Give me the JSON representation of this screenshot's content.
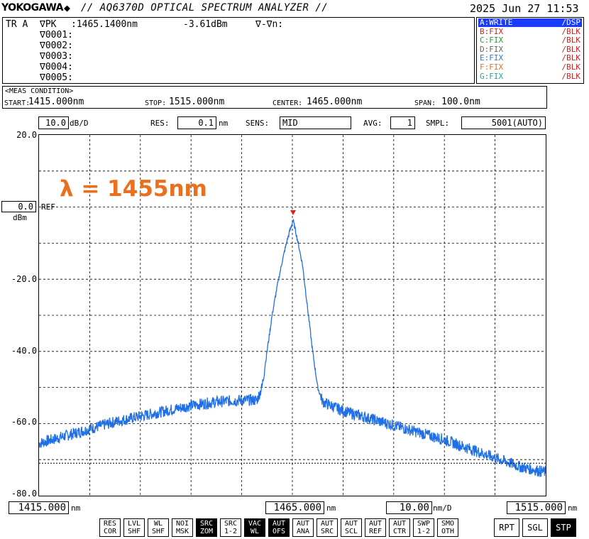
{
  "header": {
    "brand": "YOKOGAWA",
    "brand_icon": "diamond-logo-icon",
    "model_title": "// AQ6370D OPTICAL SPECTRUM ANALYZER //",
    "datetime": "2025 Jun 27 11:53"
  },
  "marker_panel": {
    "trace_label": "TR A",
    "peak_label": "∇PK",
    "peak_wavelength": ":1465.1400nm",
    "peak_level": "-3.61dBm",
    "delta_label": "∇-∇n:",
    "markers": [
      "∇0001:",
      "∇0002:",
      "∇0003:",
      "∇0004:",
      "∇0005:"
    ]
  },
  "traces": [
    {
      "name": "A:WRITE",
      "mode": "/DSP",
      "color": "#ffffff",
      "bg": "#1a3cff"
    },
    {
      "name": "B:FIX",
      "mode": "/BLK",
      "color": "#d02020",
      "bg": ""
    },
    {
      "name": "C:FIX",
      "mode": "/BLK",
      "color": "#2a9a2a",
      "bg": ""
    },
    {
      "name": "D:FIX",
      "mode": "/BLK",
      "color": "#666666",
      "bg": ""
    },
    {
      "name": "E:FIX",
      "mode": "/BLK",
      "color": "#2a7acc",
      "bg": ""
    },
    {
      "name": "F:FIX",
      "mode": "/BLK",
      "color": "#e07020",
      "bg": ""
    },
    {
      "name": "G:FIX",
      "mode": "/BLK",
      "color": "#2aa0a0",
      "bg": ""
    }
  ],
  "meas_condition": {
    "title": "<MEAS CONDITION>",
    "start_label": "START:",
    "start_value": "1415.000nm",
    "stop_label": "STOP:",
    "stop_value": "1515.000nm",
    "center_label": "CENTER:",
    "center_value": "1465.000nm",
    "span_label": "SPAN:",
    "span_value": "100.0nm"
  },
  "scale": {
    "div_value": "10.0",
    "div_unit": "dB/D",
    "res_label": "RES:",
    "res_value": "0.1",
    "res_unit": "nm",
    "sens_label": "SENS:",
    "sens_value": "MID",
    "avg_label": "AVG:",
    "avg_value": "1",
    "smpl_label": "SMPL:",
    "smpl_value": "5001(AUTO)",
    "ref_value": "0.0",
    "ref_label": "REF",
    "ref_unit": "dBm"
  },
  "y_ticks": [
    "20.0",
    "-20.0",
    "-40.0",
    "-60.0",
    "-80.0"
  ],
  "annotation": "λ = 1455nm",
  "bottom": {
    "start": "1415.000",
    "start_unit": "nm",
    "center": "1465.000",
    "center_unit": "nm",
    "per_div": "10.00",
    "per_div_unit": "nm/D",
    "stop": "1515.000",
    "stop_unit": "nm"
  },
  "softkeys": [
    {
      "l1": "RES",
      "l2": "COR",
      "on": false
    },
    {
      "l1": "LVL",
      "l2": "SHF",
      "on": false
    },
    {
      "l1": "WL",
      "l2": "SHF",
      "on": false
    },
    {
      "l1": "NOI",
      "l2": "MSK",
      "on": false
    },
    {
      "l1": "SRC",
      "l2": "ZOM",
      "on": true
    },
    {
      "l1": "SRC",
      "l2": "1-2",
      "on": false
    },
    {
      "l1": "VAC",
      "l2": "WL",
      "on": true
    },
    {
      "l1": "AUT",
      "l2": "OFS",
      "on": true
    },
    {
      "l1": "AUT",
      "l2": "ANA",
      "on": false
    },
    {
      "l1": "AUT",
      "l2": "SRC",
      "on": false
    },
    {
      "l1": "AUT",
      "l2": "SCL",
      "on": false
    },
    {
      "l1": "AUT",
      "l2": "REF",
      "on": false
    },
    {
      "l1": "AUT",
      "l2": "CTR",
      "on": false
    },
    {
      "l1": "SWP",
      "l2": "1-2",
      "on": false
    },
    {
      "l1": "SMO",
      "l2": "OTH",
      "on": false
    }
  ],
  "sweep_buttons": [
    {
      "label": "RPT",
      "on": false
    },
    {
      "label": "SGL",
      "on": false
    },
    {
      "label": "STP",
      "on": true
    }
  ],
  "trace_color": "#1f6fe8",
  "marker_color": "#e02020",
  "chart_data": {
    "type": "line",
    "xlim": [
      1415,
      1515
    ],
    "ylim": [
      -80,
      20
    ],
    "x_unit": "nm",
    "y_unit": "dBm",
    "grid": true,
    "peak": {
      "x": 1465.14,
      "y": -3.61
    },
    "x": [
      1415,
      1420,
      1425,
      1430,
      1435,
      1440,
      1445,
      1450,
      1455,
      1458,
      1459,
      1460,
      1461,
      1462,
      1463,
      1464,
      1465.14,
      1466,
      1467,
      1468,
      1469,
      1470,
      1471,
      1475,
      1480,
      1485,
      1490,
      1495,
      1500,
      1505,
      1510,
      1515
    ],
    "y": [
      -65.5,
      -63.5,
      -61.5,
      -59.5,
      -58,
      -56.5,
      -55,
      -54,
      -53.5,
      -53.5,
      -50,
      -40,
      -30,
      -22,
      -15,
      -9,
      -3.6,
      -9,
      -16,
      -28,
      -40,
      -50,
      -54,
      -56.5,
      -58.5,
      -60.5,
      -62.5,
      -64.5,
      -67,
      -69.5,
      -72,
      -73.5
    ]
  }
}
